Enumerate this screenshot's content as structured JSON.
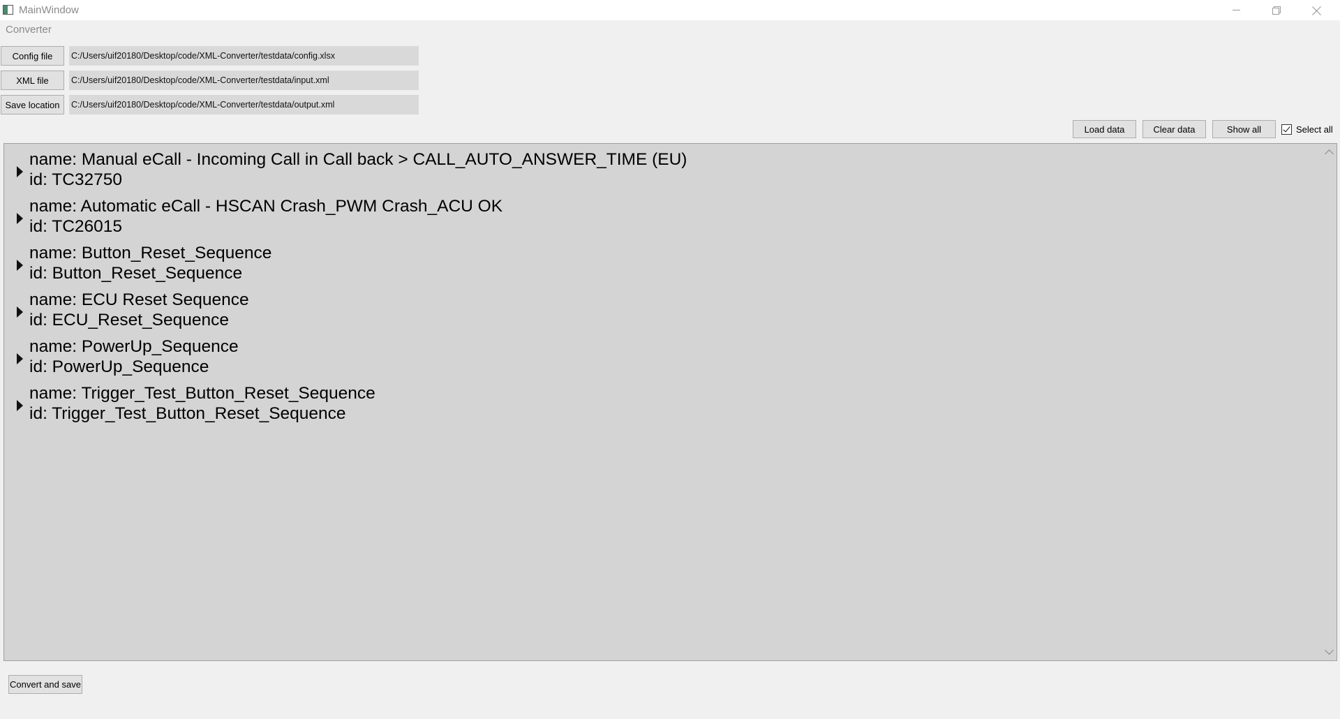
{
  "window": {
    "title": "MainWindow"
  },
  "menu": {
    "items": [
      "Converter"
    ]
  },
  "files": {
    "config_button": "Config file",
    "config_path": "C:/Users/uif20180/Desktop/code/XML-Converter/testdata/config.xlsx",
    "xml_button": "XML file",
    "xml_path": "C:/Users/uif20180/Desktop/code/XML-Converter/testdata/input.xml",
    "save_button": "Save location",
    "save_path": "C:/Users/uif20180/Desktop/code/XML-Converter/testdata/output.xml"
  },
  "actions": {
    "load_label": "Load data",
    "clear_label": "Clear data",
    "show_label": "Show all",
    "select_all_label": "Select all",
    "select_all_checked": true
  },
  "tree": {
    "items": [
      {
        "name": "name: Manual eCall - Incoming Call in Call back > CALL_AUTO_ANSWER_TIME (EU)",
        "id": "id: TC32750",
        "expanded": false
      },
      {
        "name": "name: Automatic eCall - HSCAN Crash_PWM Crash_ACU OK",
        "id": "id: TC26015",
        "expanded": false
      },
      {
        "name": "name: Button_Reset_Sequence",
        "id": "id: Button_Reset_Sequence",
        "expanded": false
      },
      {
        "name": "name: ECU Reset Sequence",
        "id": "id: ECU_Reset_Sequence",
        "expanded": false
      },
      {
        "name": "name: PowerUp_Sequence",
        "id": "id: PowerUp_Sequence",
        "expanded": false
      },
      {
        "name": "name: Trigger_Test_Button_Reset_Sequence",
        "id": "id: Trigger_Test_Button_Reset_Sequence",
        "expanded": false
      }
    ]
  },
  "footer": {
    "convert_label": "Convert and save"
  },
  "colors": {
    "background": "#f0f0f0",
    "tree_background": "#d4d4d4",
    "button_face": "#e1e1e1",
    "path_field": "#d9d9d9"
  }
}
